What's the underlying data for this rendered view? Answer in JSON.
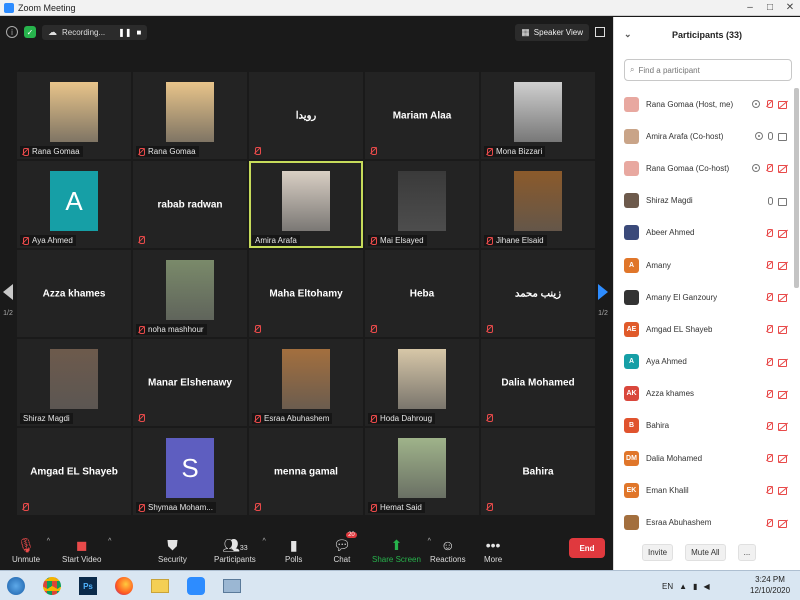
{
  "window": {
    "title": "Zoom Meeting",
    "controls": [
      "–",
      "□",
      "✕"
    ]
  },
  "topbar": {
    "recording_label": "Recording...",
    "speaker_view_label": "Speaker View"
  },
  "tiles": [
    {
      "name": "Rana Gomaa",
      "kind": "photo",
      "photo_bg": "#e8c48a",
      "muted": true
    },
    {
      "name": "Rana Gomaa",
      "kind": "photo",
      "photo_bg": "#e8c48a",
      "muted": true
    },
    {
      "name": "",
      "bigname": "رويدا",
      "kind": "name",
      "muted": true
    },
    {
      "name": "",
      "bigname": "Mariam Alaa",
      "kind": "name",
      "muted": true
    },
    {
      "name": "Mona Bizzari",
      "kind": "photo",
      "photo_bg": "#cfcfcf",
      "muted": true
    },
    {
      "name": "Aya Ahmed",
      "kind": "avatar",
      "letter": "A",
      "avatar_bg": "#169fa6",
      "muted": true
    },
    {
      "name": "",
      "bigname": "rabab radwan",
      "kind": "name",
      "muted": true
    },
    {
      "name": "Amira Arafa",
      "kind": "photo",
      "photo_bg": "#d9cfc4",
      "muted": false,
      "active": true
    },
    {
      "name": "Mai Elsayed",
      "kind": "photo",
      "photo_bg": "#3a3a3a",
      "muted": true
    },
    {
      "name": "Jihane Elsaid",
      "kind": "photo",
      "photo_bg": "#8b5a2b",
      "muted": true
    },
    {
      "name": "",
      "bigname": "Azza khames",
      "kind": "name",
      "muted": false
    },
    {
      "name": "noha mashhour",
      "kind": "photo",
      "photo_bg": "#7a8a6a",
      "muted": true
    },
    {
      "name": "",
      "bigname": "Maha Eltohamy",
      "kind": "name",
      "muted": true
    },
    {
      "name": "",
      "bigname": "Heba",
      "kind": "name",
      "muted": true
    },
    {
      "name": "",
      "bigname": "زينب محمد",
      "kind": "name",
      "muted": true
    },
    {
      "name": "Shiraz Magdi",
      "kind": "photo",
      "photo_bg": "#6d5a4c",
      "muted": false
    },
    {
      "name": "",
      "bigname": "Manar Elshenawy",
      "kind": "name",
      "muted": true
    },
    {
      "name": "Esraa Abuhashem",
      "kind": "photo",
      "photo_bg": "#a36f3e",
      "muted": true
    },
    {
      "name": "Hoda Dahroug",
      "kind": "photo",
      "photo_bg": "#d7c7a8",
      "muted": true
    },
    {
      "name": "",
      "bigname": "Dalia Mohamed",
      "kind": "name",
      "muted": true
    },
    {
      "name": "",
      "bigname": "Amgad EL Shayeb",
      "kind": "name",
      "muted": true
    },
    {
      "name": "Shymaa Moham...",
      "kind": "avatar",
      "letter": "S",
      "avatar_bg": "#5e5ec0",
      "muted": true
    },
    {
      "name": "",
      "bigname": "menna gamal",
      "kind": "name",
      "muted": true
    },
    {
      "name": "Hemat Said",
      "kind": "photo",
      "photo_bg": "#9fb38a",
      "muted": true
    },
    {
      "name": "",
      "bigname": "Bahira",
      "kind": "name",
      "muted": true
    }
  ],
  "pager": {
    "left": "1/2",
    "right": "1/2"
  },
  "toolbar": {
    "unmute": "Unmute",
    "start_video": "Start Video",
    "security": "Security",
    "participants": "Participants",
    "participants_count": "33",
    "polls": "Polls",
    "chat": "Chat",
    "chat_badge": "20",
    "share_screen": "Share Screen",
    "reactions": "Reactions",
    "more": "More",
    "end": "End"
  },
  "panel": {
    "title": "Participants (33)",
    "search_placeholder": "Find a participant",
    "invite": "Invite",
    "mute_all": "Mute All",
    "more": "...",
    "participants": [
      {
        "name": "Rana Gomaa (Host, me)",
        "avatar": "photo",
        "bg": "#e8a8a0",
        "icons": [
          "rec",
          "mute",
          "camoff"
        ]
      },
      {
        "name": "Amira Arafa (Co-host)",
        "avatar": "photo",
        "bg": "#c9a488",
        "icons": [
          "rec",
          "mic",
          "camgray"
        ]
      },
      {
        "name": "Rana Gomaa (Co-host)",
        "avatar": "photo",
        "bg": "#e8a8a0",
        "icons": [
          "rec",
          "mute",
          "camoff"
        ]
      },
      {
        "name": "Shiraz Magdi",
        "avatar": "photo",
        "bg": "#6d5a4c",
        "icons": [
          "mic",
          "camgray"
        ]
      },
      {
        "name": "Abeer Ahmed",
        "avatar": "photo",
        "bg": "#3b4a7a",
        "icons": [
          "mute",
          "camoff"
        ]
      },
      {
        "name": "Amany",
        "avatar": "A",
        "bg": "#e0762a",
        "icons": [
          "mute",
          "camoff"
        ]
      },
      {
        "name": "Amany El Ganzoury",
        "avatar": "photo",
        "bg": "#333333",
        "icons": [
          "mute",
          "camoff"
        ]
      },
      {
        "name": "Amgad EL Shayeb",
        "avatar": "AE",
        "bg": "#e05a2a",
        "icons": [
          "mute",
          "camoff"
        ]
      },
      {
        "name": "Aya Ahmed",
        "avatar": "A",
        "bg": "#169fa6",
        "icons": [
          "mute",
          "camoff"
        ]
      },
      {
        "name": "Azza khames",
        "avatar": "AK",
        "bg": "#d9473c",
        "icons": [
          "mute",
          "camoff"
        ]
      },
      {
        "name": "Bahira",
        "avatar": "B",
        "bg": "#e0532e",
        "icons": [
          "mute",
          "camoff"
        ]
      },
      {
        "name": "Dalia Mohamed",
        "avatar": "DM",
        "bg": "#e0762a",
        "icons": [
          "mute",
          "camoff"
        ]
      },
      {
        "name": "Eman Khalil",
        "avatar": "EK",
        "bg": "#e0762a",
        "icons": [
          "mute",
          "camoff"
        ]
      },
      {
        "name": "Esraa Abuhashem",
        "avatar": "photo",
        "bg": "#a36f3e",
        "icons": [
          "mute",
          "camoff"
        ]
      }
    ]
  },
  "taskbar": {
    "language": "EN",
    "time": "3:24 PM",
    "date": "12/10/2020"
  }
}
